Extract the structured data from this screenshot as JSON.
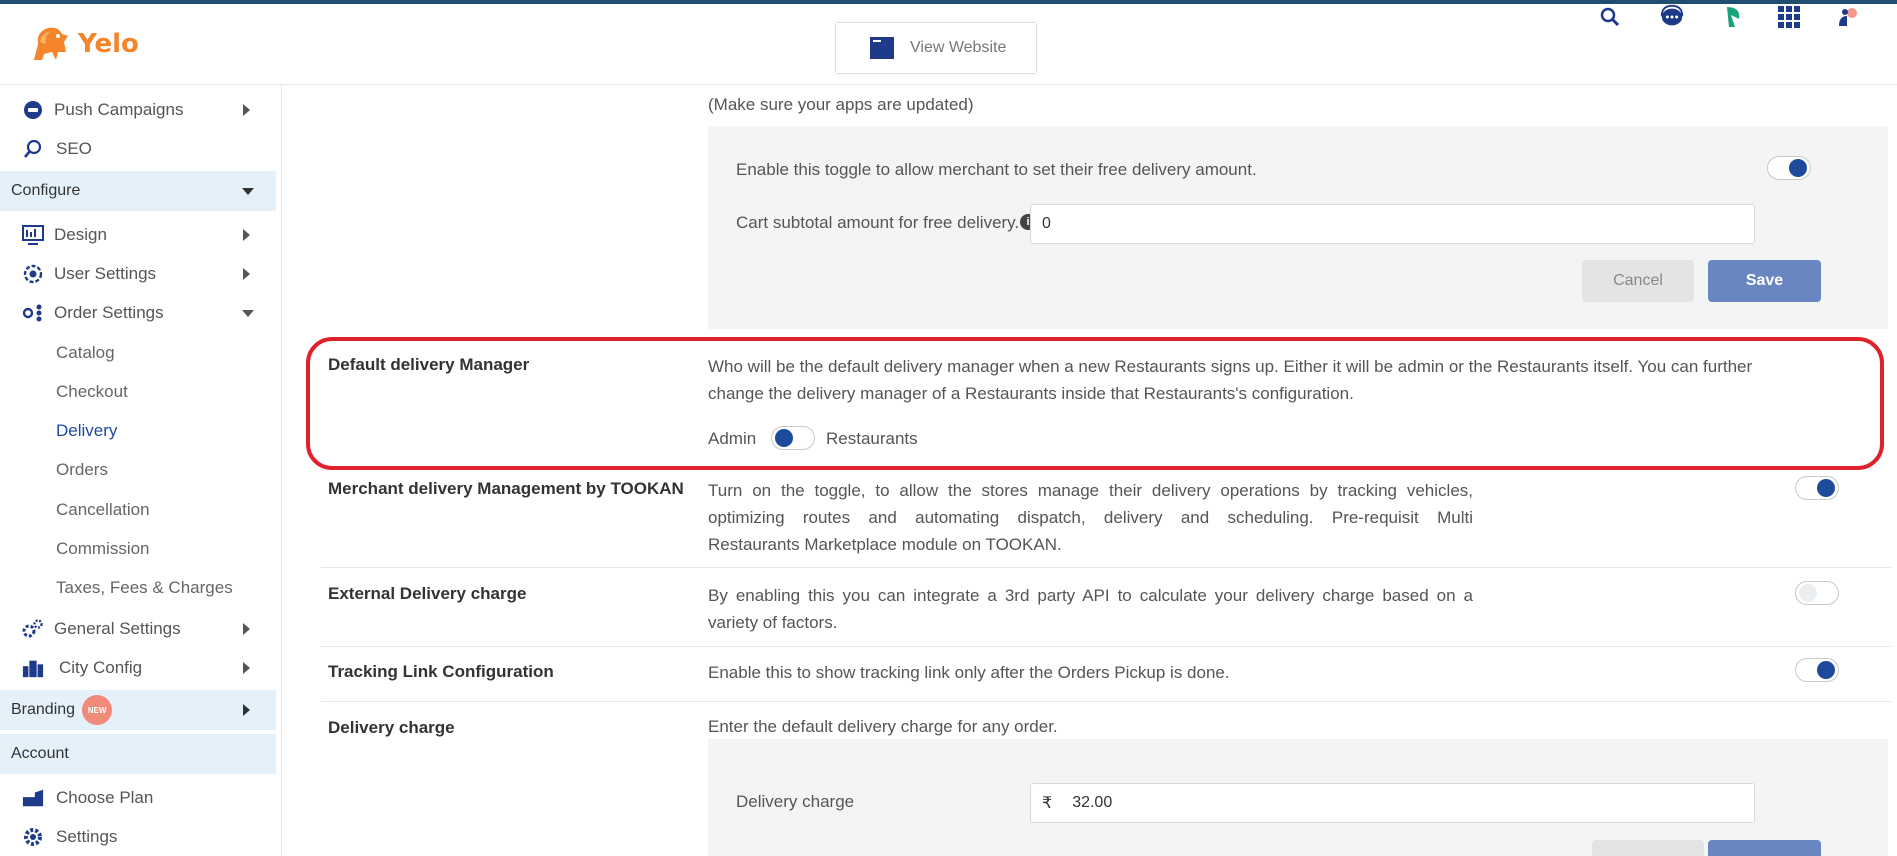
{
  "header": {
    "brand": "Yelo",
    "view_website": "View Website",
    "icons": [
      "search-icon",
      "support-chat-icon",
      "leaf-icon",
      "apps-grid-icon",
      "profile-icon"
    ]
  },
  "sidebar": {
    "items_top": [
      {
        "label": "Push Campaigns",
        "icon": "push-campaign-icon"
      },
      {
        "label": "SEO",
        "icon": "seo-search-icon"
      }
    ],
    "configure_label": "Configure",
    "configure_items": [
      {
        "label": "Design",
        "icon": "design-icon"
      },
      {
        "label": "User Settings",
        "icon": "user-settings-icon"
      },
      {
        "label": "Order Settings",
        "icon": "order-settings-icon"
      }
    ],
    "order_sub": [
      "Catalog",
      "Checkout",
      "Delivery",
      "Orders",
      "Cancellation",
      "Commission",
      "Taxes, Fees & Charges"
    ],
    "more_items": [
      {
        "label": "General Settings",
        "icon": "general-settings-icon"
      },
      {
        "label": "City Config",
        "icon": "city-config-icon"
      }
    ],
    "branding_label": "Branding",
    "new_badge": "NEW",
    "account_label": "Account",
    "account_items": [
      {
        "label": "Choose Plan",
        "icon": "choose-plan-icon"
      },
      {
        "label": "Settings",
        "icon": "settings-gear-icon"
      }
    ]
  },
  "main": {
    "apps_note": "(Make sure your apps are updated)",
    "free_delivery": {
      "toggle_text": "Enable this toggle to allow merchant to set their free delivery amount.",
      "toggle_on": true,
      "subtotal_label": "Cart subtotal amount for free delivery.",
      "subtotal_value": "0",
      "cancel": "Cancel",
      "save": "Save"
    },
    "default_delivery_manager": {
      "label": "Default delivery Manager",
      "description_line1": "Who will be the default delivery manager when a new Restaurants signs up. Either it will be admin or the Restaurants itself. You can further",
      "description_line2": "change the delivery manager of a Restaurants inside that Restaurants's configuration.",
      "option_left": "Admin",
      "option_right": "Restaurants"
    },
    "merchant_tookan": {
      "label": "Merchant delivery Management by TOOKAN",
      "line1": "Turn on the toggle, to allow the stores manage their delivery operations by tracking vehicles,",
      "line2": "optimizing routes and automating dispatch, delivery and scheduling. Pre-requisit Multi",
      "line3": "Restaurants Marketplace module on TOOKAN.",
      "toggle_on": true
    },
    "external_delivery": {
      "label": "External Delivery charge",
      "line1": "By enabling this you can integrate a 3rd party API to calculate your delivery charge based on a",
      "line2": "variety of factors.",
      "toggle_on": false
    },
    "tracking_link": {
      "label": "Tracking Link Configuration",
      "text": "Enable this to show tracking link only after the Orders Pickup is done.",
      "toggle_on": true
    },
    "delivery_charge": {
      "label": "Delivery charge",
      "text": "Enter the default delivery charge for any order.",
      "field_label": "Delivery charge",
      "currency": "₹",
      "value": "32.00"
    }
  },
  "colors": {
    "accent": "#1e4a9c",
    "brand": "#f5852b",
    "highlight": "#e0212b"
  }
}
